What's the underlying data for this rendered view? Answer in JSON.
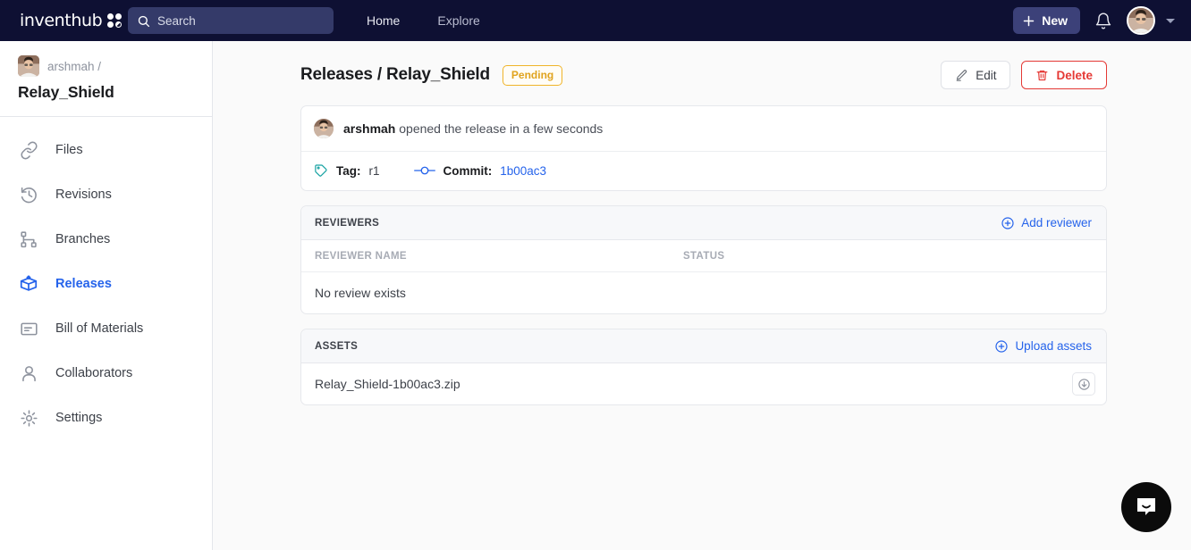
{
  "topnav": {
    "logo_text": "inventhub",
    "logo_icon": "dots-grid-icon",
    "search": {
      "placeholder": "Search",
      "icon": "search-icon"
    },
    "links": [
      {
        "label": "Home",
        "active": true
      },
      {
        "label": "Explore",
        "active": false
      }
    ],
    "new_button": {
      "label": "New",
      "icon": "plus-icon"
    },
    "notifications_icon": "bell-icon",
    "avatar": "user-avatar",
    "caret_icon": "chevron-down-icon"
  },
  "sidebar": {
    "owner": "arshmah /",
    "repo_name": "Relay_Shield",
    "items": [
      {
        "label": "Files",
        "icon": "link-icon",
        "active": false
      },
      {
        "label": "Revisions",
        "icon": "history-icon",
        "active": false
      },
      {
        "label": "Branches",
        "icon": "branches-icon",
        "active": false
      },
      {
        "label": "Releases",
        "icon": "package-icon",
        "active": true
      },
      {
        "label": "Bill of Materials",
        "icon": "document-list-icon",
        "active": false
      },
      {
        "label": "Collaborators",
        "icon": "user-icon",
        "active": false
      },
      {
        "label": "Settings",
        "icon": "gear-icon",
        "active": false
      }
    ]
  },
  "page": {
    "title": "Releases / Relay_Shield",
    "status_badge": "Pending",
    "edit_button": "Edit",
    "delete_button": "Delete"
  },
  "release": {
    "author": "arshmah",
    "activity_text": "opened the release in a few seconds",
    "tag_label": "Tag:",
    "tag_value": "r1",
    "commit_label": "Commit:",
    "commit_value": "1b00ac3"
  },
  "reviewers": {
    "section_title": "REVIEWERS",
    "add_action": "Add reviewer",
    "columns": [
      "REVIEWER NAME",
      "STATUS"
    ],
    "empty_text": "No review exists"
  },
  "assets": {
    "section_title": "ASSETS",
    "upload_action": "Upload assets",
    "rows": [
      {
        "name": "Relay_Shield-1b00ac3.zip",
        "download_icon": "download-circle-icon"
      }
    ]
  },
  "chat": {
    "icon": "chat-bubble-smile-icon"
  },
  "colors": {
    "nav_bg": "#0e1033",
    "accent_blue": "#2563eb",
    "danger_red": "#e53935",
    "warning_yellow": "#f0b429",
    "tag_teal": "#17a2a2",
    "page_bg": "#fafafa"
  }
}
